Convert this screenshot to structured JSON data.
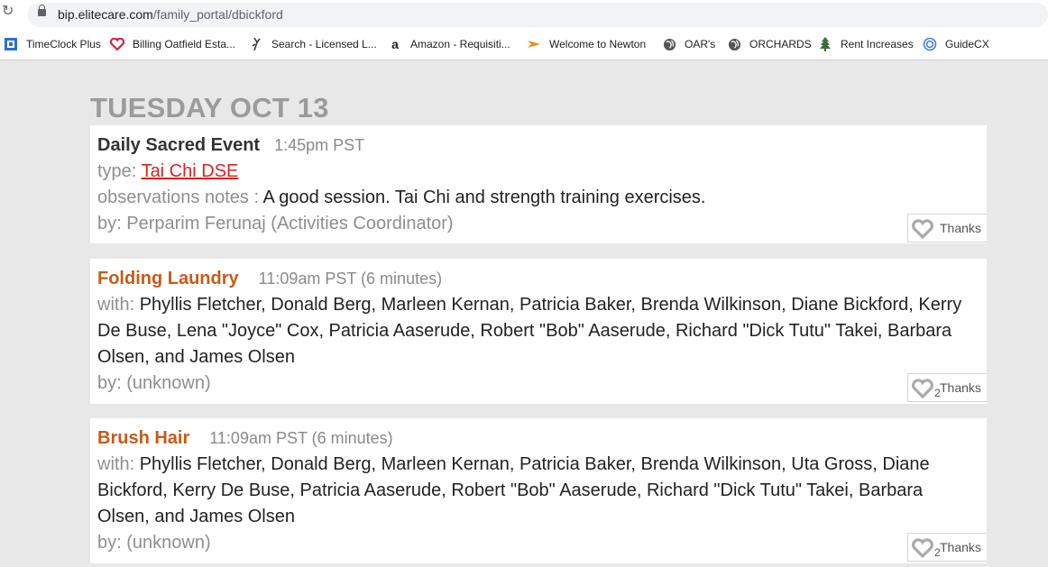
{
  "browser": {
    "url_domain": "bip.elitecare.com",
    "url_path": "/family_portal/dbickford",
    "bookmarks": [
      {
        "label": "TimeClock Plus",
        "icon": "timeclock-icon",
        "color": "#2a6fd6"
      },
      {
        "label": "Billing Oatfield Esta...",
        "icon": "heart-icon",
        "color": "#d6203a"
      },
      {
        "label": "Search - Licensed L...",
        "icon": "figure-icon",
        "color": "#333333"
      },
      {
        "label": "Amazon - Requisiti...",
        "icon": "amazon-icon",
        "color": "#222222"
      },
      {
        "label": "Welcome to Newton",
        "icon": "arrow-icon",
        "color": "#f08a18"
      },
      {
        "label": "OAR's",
        "icon": "globe-icon",
        "color": "#555555"
      },
      {
        "label": "ORCHARDS",
        "icon": "globe-icon",
        "color": "#555555"
      },
      {
        "label": "Rent Increases",
        "icon": "tree-icon",
        "color": "#3b6e3b"
      },
      {
        "label": "GuideCX",
        "icon": "guidecx-icon",
        "color": "#4a7bd8"
      }
    ]
  },
  "feed": {
    "date_heading": "TUESDAY OCT 13",
    "events": [
      {
        "title": "Daily Sacred Event",
        "time": "1:45pm PST",
        "type_label": "type:",
        "type_value": "Tai Chi DSE",
        "notes_label": "observations notes :",
        "notes_value": "A good session. Tai Chi and strength training exercises.",
        "by_text": "by: Perparim Ferunaj (Activities Coordinator)",
        "thanks_label": "Thanks",
        "thanks_count": ""
      },
      {
        "title": "Folding Laundry",
        "time": "11:09am PST (6 minutes)",
        "with_label": "with:",
        "with_value": "Phyllis Fletcher, Donald Berg, Marleen Kernan, Patricia Baker, Brenda Wilkinson, Diane Bickford, Kerry De Buse, Lena \"Joyce\" Cox, Patricia Aaserude, Robert \"Bob\" Aaserude, Richard \"Dick Tutu\" Takei, Barbara Olsen, and James Olsen",
        "by_text": "by: (unknown)",
        "thanks_label": "Thanks",
        "thanks_count": "2"
      },
      {
        "title": "Brush Hair",
        "time": "11:09am PST (6 minutes)",
        "with_label": "with:",
        "with_value": "Phyllis Fletcher, Donald Berg, Marleen Kernan, Patricia Baker, Brenda Wilkinson, Uta Gross, Diane Bickford, Kerry De Buse, Patricia Aaserude, Robert \"Bob\" Aaserude, Richard \"Dick Tutu\" Takei, Barbara Olsen, and James Olsen",
        "by_text": "by: (unknown)",
        "thanks_label": "Thanks",
        "thanks_count": "2"
      }
    ]
  }
}
